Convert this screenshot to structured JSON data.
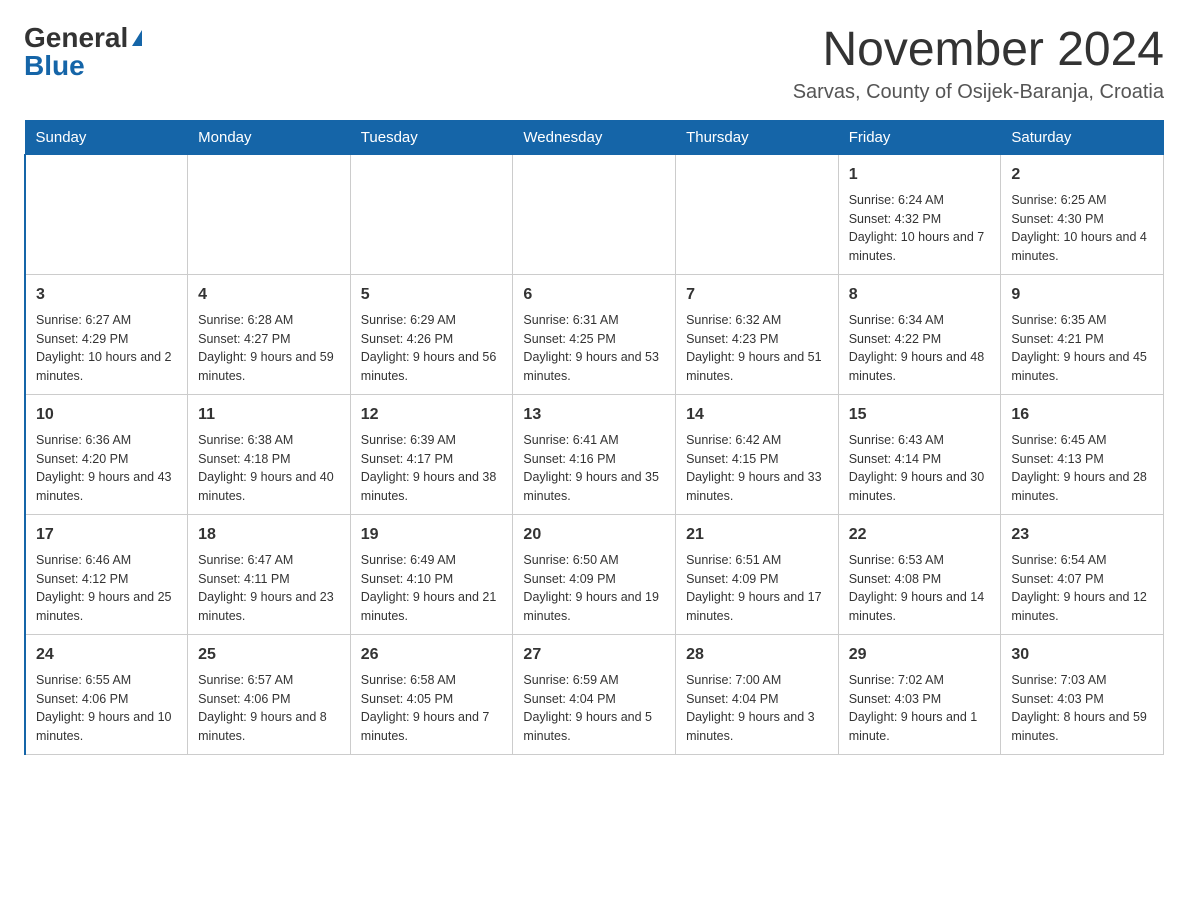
{
  "logo": {
    "general": "General",
    "blue": "Blue"
  },
  "title": "November 2024",
  "location": "Sarvas, County of Osijek-Baranja, Croatia",
  "headers": [
    "Sunday",
    "Monday",
    "Tuesday",
    "Wednesday",
    "Thursday",
    "Friday",
    "Saturday"
  ],
  "weeks": [
    [
      {
        "day": "",
        "info": ""
      },
      {
        "day": "",
        "info": ""
      },
      {
        "day": "",
        "info": ""
      },
      {
        "day": "",
        "info": ""
      },
      {
        "day": "",
        "info": ""
      },
      {
        "day": "1",
        "info": "Sunrise: 6:24 AM\nSunset: 4:32 PM\nDaylight: 10 hours and 7 minutes."
      },
      {
        "day": "2",
        "info": "Sunrise: 6:25 AM\nSunset: 4:30 PM\nDaylight: 10 hours and 4 minutes."
      }
    ],
    [
      {
        "day": "3",
        "info": "Sunrise: 6:27 AM\nSunset: 4:29 PM\nDaylight: 10 hours and 2 minutes."
      },
      {
        "day": "4",
        "info": "Sunrise: 6:28 AM\nSunset: 4:27 PM\nDaylight: 9 hours and 59 minutes."
      },
      {
        "day": "5",
        "info": "Sunrise: 6:29 AM\nSunset: 4:26 PM\nDaylight: 9 hours and 56 minutes."
      },
      {
        "day": "6",
        "info": "Sunrise: 6:31 AM\nSunset: 4:25 PM\nDaylight: 9 hours and 53 minutes."
      },
      {
        "day": "7",
        "info": "Sunrise: 6:32 AM\nSunset: 4:23 PM\nDaylight: 9 hours and 51 minutes."
      },
      {
        "day": "8",
        "info": "Sunrise: 6:34 AM\nSunset: 4:22 PM\nDaylight: 9 hours and 48 minutes."
      },
      {
        "day": "9",
        "info": "Sunrise: 6:35 AM\nSunset: 4:21 PM\nDaylight: 9 hours and 45 minutes."
      }
    ],
    [
      {
        "day": "10",
        "info": "Sunrise: 6:36 AM\nSunset: 4:20 PM\nDaylight: 9 hours and 43 minutes."
      },
      {
        "day": "11",
        "info": "Sunrise: 6:38 AM\nSunset: 4:18 PM\nDaylight: 9 hours and 40 minutes."
      },
      {
        "day": "12",
        "info": "Sunrise: 6:39 AM\nSunset: 4:17 PM\nDaylight: 9 hours and 38 minutes."
      },
      {
        "day": "13",
        "info": "Sunrise: 6:41 AM\nSunset: 4:16 PM\nDaylight: 9 hours and 35 minutes."
      },
      {
        "day": "14",
        "info": "Sunrise: 6:42 AM\nSunset: 4:15 PM\nDaylight: 9 hours and 33 minutes."
      },
      {
        "day": "15",
        "info": "Sunrise: 6:43 AM\nSunset: 4:14 PM\nDaylight: 9 hours and 30 minutes."
      },
      {
        "day": "16",
        "info": "Sunrise: 6:45 AM\nSunset: 4:13 PM\nDaylight: 9 hours and 28 minutes."
      }
    ],
    [
      {
        "day": "17",
        "info": "Sunrise: 6:46 AM\nSunset: 4:12 PM\nDaylight: 9 hours and 25 minutes."
      },
      {
        "day": "18",
        "info": "Sunrise: 6:47 AM\nSunset: 4:11 PM\nDaylight: 9 hours and 23 minutes."
      },
      {
        "day": "19",
        "info": "Sunrise: 6:49 AM\nSunset: 4:10 PM\nDaylight: 9 hours and 21 minutes."
      },
      {
        "day": "20",
        "info": "Sunrise: 6:50 AM\nSunset: 4:09 PM\nDaylight: 9 hours and 19 minutes."
      },
      {
        "day": "21",
        "info": "Sunrise: 6:51 AM\nSunset: 4:09 PM\nDaylight: 9 hours and 17 minutes."
      },
      {
        "day": "22",
        "info": "Sunrise: 6:53 AM\nSunset: 4:08 PM\nDaylight: 9 hours and 14 minutes."
      },
      {
        "day": "23",
        "info": "Sunrise: 6:54 AM\nSunset: 4:07 PM\nDaylight: 9 hours and 12 minutes."
      }
    ],
    [
      {
        "day": "24",
        "info": "Sunrise: 6:55 AM\nSunset: 4:06 PM\nDaylight: 9 hours and 10 minutes."
      },
      {
        "day": "25",
        "info": "Sunrise: 6:57 AM\nSunset: 4:06 PM\nDaylight: 9 hours and 8 minutes."
      },
      {
        "day": "26",
        "info": "Sunrise: 6:58 AM\nSunset: 4:05 PM\nDaylight: 9 hours and 7 minutes."
      },
      {
        "day": "27",
        "info": "Sunrise: 6:59 AM\nSunset: 4:04 PM\nDaylight: 9 hours and 5 minutes."
      },
      {
        "day": "28",
        "info": "Sunrise: 7:00 AM\nSunset: 4:04 PM\nDaylight: 9 hours and 3 minutes."
      },
      {
        "day": "29",
        "info": "Sunrise: 7:02 AM\nSunset: 4:03 PM\nDaylight: 9 hours and 1 minute."
      },
      {
        "day": "30",
        "info": "Sunrise: 7:03 AM\nSunset: 4:03 PM\nDaylight: 8 hours and 59 minutes."
      }
    ]
  ]
}
